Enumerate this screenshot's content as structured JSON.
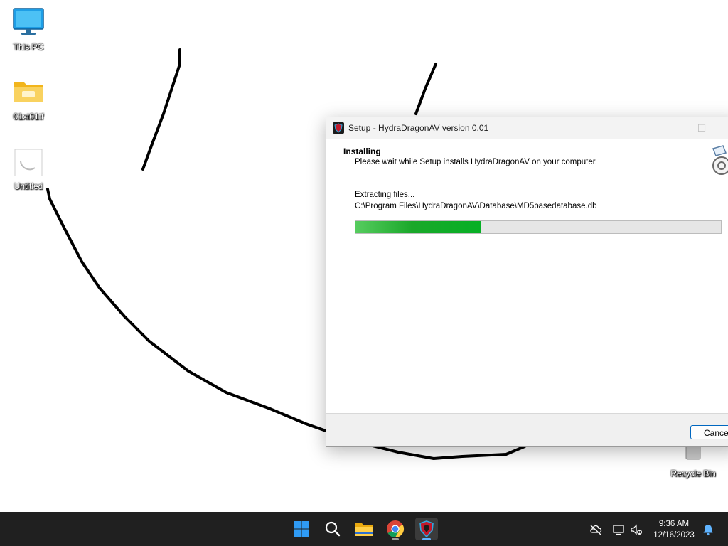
{
  "desktop": {
    "icons": [
      {
        "label": "This PC",
        "icon": "monitor-icon"
      },
      {
        "label": "01xt01tf",
        "icon": "folder-icon"
      },
      {
        "label": "Untitled",
        "icon": "paint-file-icon"
      },
      {
        "label": "Recycle Bin",
        "icon": "recycle-bin-icon"
      }
    ]
  },
  "dialog": {
    "title": "Setup - HydraDragonAV version 0.01",
    "app_icon": "hydradragon-shield-icon",
    "header_title": "Installing",
    "header_description": "Please wait while Setup installs HydraDragonAV on your computer.",
    "status": "Extracting files...",
    "current_file": "C:\\Program Files\\HydraDragonAV\\Database\\MD5basedatabase.db",
    "progress_fraction": 0.345,
    "cancel_label": "Cancel",
    "colors": {
      "progress": "#06b025",
      "accent": "#0067c0"
    }
  },
  "taskbar": {
    "apps": [
      {
        "name": "start",
        "icon": "windows-start-icon"
      },
      {
        "name": "search",
        "icon": "search-icon"
      },
      {
        "name": "file-explorer",
        "icon": "folder-icon"
      },
      {
        "name": "chrome",
        "icon": "chrome-icon"
      },
      {
        "name": "hydradragon-setup",
        "icon": "hydradragon-shield-icon"
      }
    ],
    "tray": [
      "cloud-off-icon",
      "display-icon",
      "muted-speaker-icon",
      "notification-bell-icon"
    ],
    "time": "9:36 AM",
    "date": "12/16/2023"
  }
}
